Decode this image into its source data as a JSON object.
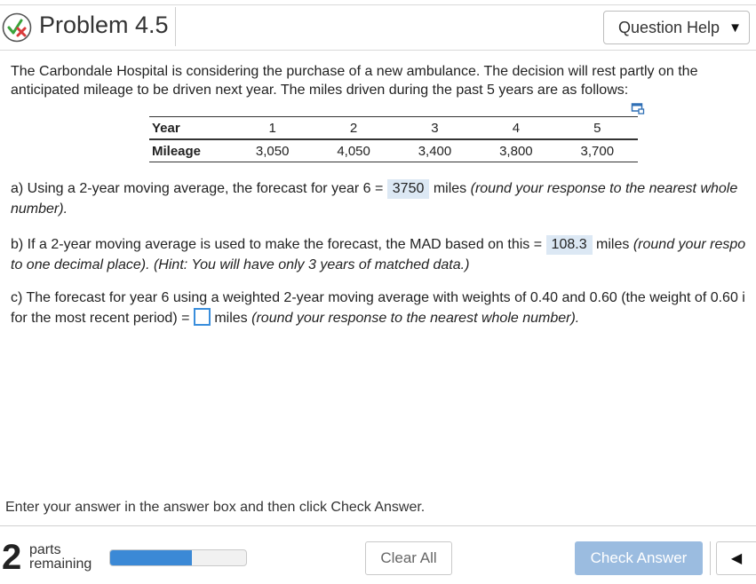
{
  "header": {
    "title": "Problem 4.5",
    "help_label": "Question Help",
    "help_caret": "▼"
  },
  "statement": "The Carbondale Hospital is considering the purchase of a new ambulance. The decision will rest partly on the anticipated mileage to be driven next year. The miles driven during the past 5 years are as follows:",
  "table": {
    "row_labels": [
      "Year",
      "Mileage"
    ],
    "years": [
      "1",
      "2",
      "3",
      "4",
      "5"
    ],
    "mileage": [
      "3,050",
      "4,050",
      "3,400",
      "3,800",
      "3,700"
    ]
  },
  "part_a": {
    "text": "a) Using a 2-year moving average, the forecast for year 6 =",
    "answer": "3750",
    "unit": "miles",
    "note": "(round your response to the nearest whole",
    "note2": "number)."
  },
  "part_b": {
    "text": "b) If a 2-year moving average is used to make the forecast, the MAD based on this =",
    "answer": "108.3",
    "unit": "miles",
    "note": "(round your respo",
    "note2": "to one decimal place).  (Hint: You will have only 3 years of matched data.)"
  },
  "part_c": {
    "text": "c) The forecast for year 6 using a weighted 2-year moving average with weights of 0.40 and 0.60 (the weight of 0.60 i",
    "line2_start": "for the most recent period) =",
    "answer": "",
    "unit": "miles",
    "note": "(round your response to the nearest whole number)."
  },
  "instruction": "Enter your answer in the answer box and then click Check Answer.",
  "footer": {
    "parts_count": "2",
    "parts_label_1": "parts",
    "parts_label_2": "remaining",
    "progress": 0.6,
    "clear_label": "Clear All",
    "check_label": "Check Answer",
    "back_glyph": "◀"
  },
  "colors": {
    "accent": "#3b89d6",
    "answer_highlight": "#dce8f4",
    "check_button": "#9bbce0"
  },
  "icons": {
    "status": "partially-correct-icon",
    "table": "copy-table-icon"
  }
}
